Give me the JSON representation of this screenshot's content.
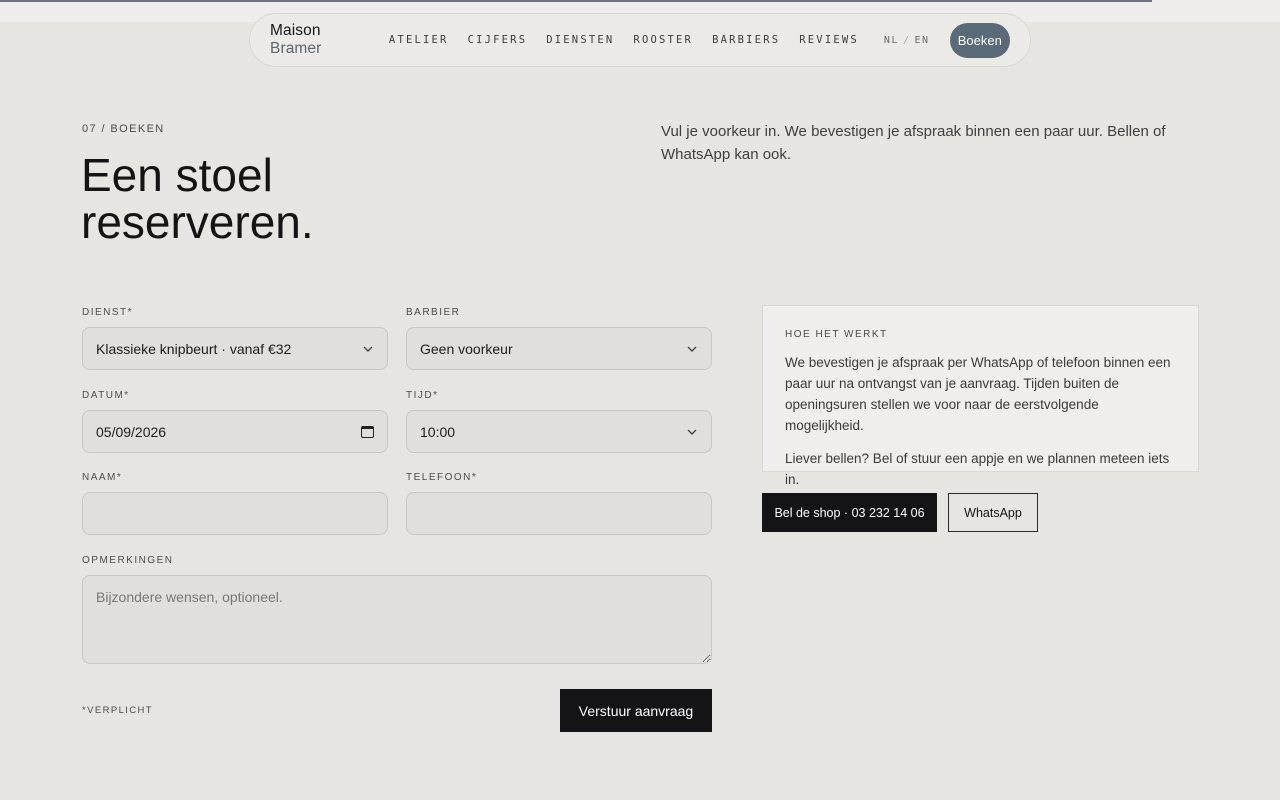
{
  "page": {
    "scroll_progress_percent": 90
  },
  "nav": {
    "brand_primary": "Maison",
    "brand_secondary": "Bramer",
    "links": [
      "ATELIER",
      "CIJFERS",
      "DIENSTEN",
      "ROOSTER",
      "BARBIERS",
      "REVIEWS"
    ],
    "lang_nl": "NL",
    "lang_sep": "/",
    "lang_en": "EN",
    "cta": "Boeken"
  },
  "hero": {
    "eyebrow": "07 / BOEKEN",
    "title_line1": "Een stoel",
    "title_line2": "reserveren.",
    "intro": "Vul je voorkeur in. We bevestigen je afspraak binnen een paar uur. Bellen of WhatsApp kan ook."
  },
  "form": {
    "dienst_label": "DIENST*",
    "dienst_value": "Klassieke knipbeurt · vanaf €32",
    "barbier_label": "BARBIER",
    "barbier_value": "Geen voorkeur",
    "datum_label": "DATUM*",
    "datum_value": "05/09/2026",
    "tijd_label": "TIJD*",
    "tijd_value": "10:00",
    "naam_label": "NAAM*",
    "telefoon_label": "TELEFOON*",
    "opmerkingen_label": "OPMERKINGEN",
    "opmerkingen_placeholder": "Bijzondere wensen, optioneel.",
    "required_note": "*VERPLICHT",
    "submit": "Verstuur aanvraag"
  },
  "how": {
    "title": "HOE HET WERKT",
    "p1": "We bevestigen je afspraak per WhatsApp of telefoon binnen een paar uur na ontvangst van je aanvraag. Tijden buiten de openingsuren stellen we voor naar de eerstvolgende mogelijkheid.",
    "p2": "Liever bellen? Bel of stuur een appje en we plannen meteen iets in."
  },
  "contact": {
    "call": "Bel de shop · 03 232 14 06",
    "whatsapp": "WhatsApp"
  }
}
